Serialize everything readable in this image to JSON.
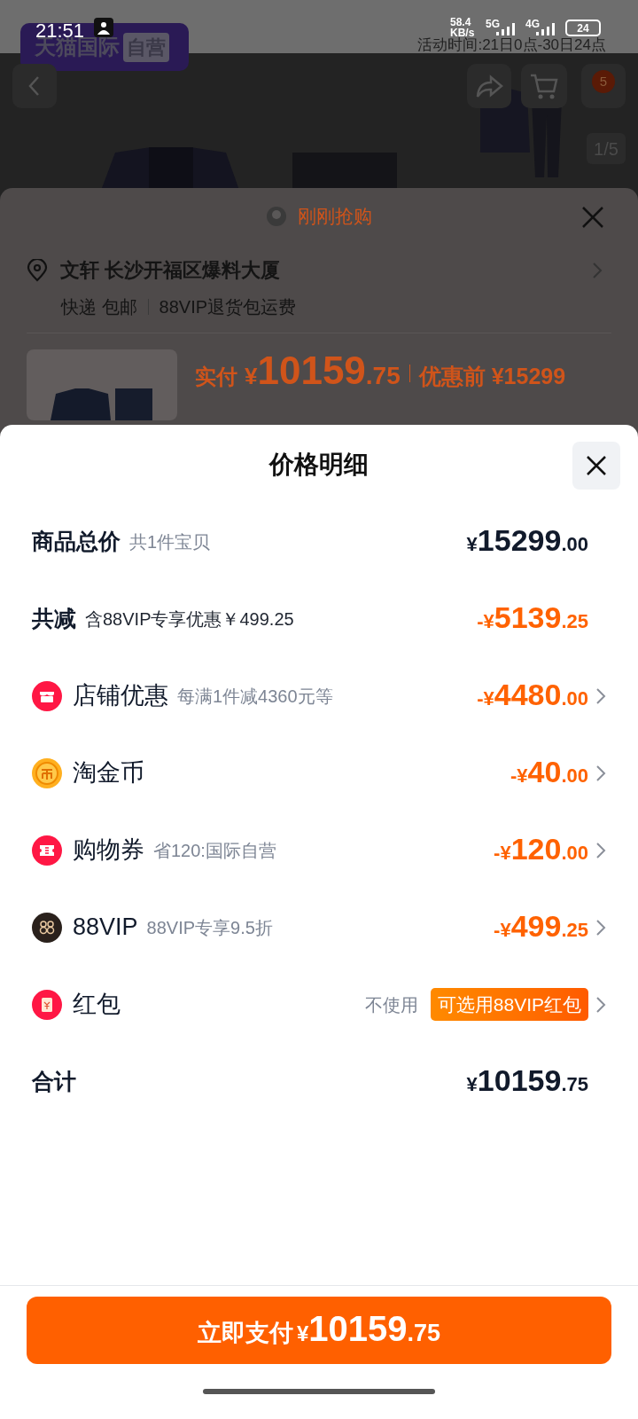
{
  "status_bar": {
    "time": "21:51",
    "speed_value": "58.4",
    "speed_unit": "KB/s",
    "networks": [
      "5G",
      "4G"
    ],
    "battery": "24"
  },
  "banner": {
    "logo": "天猫国际",
    "logo_tag": "自营",
    "activity": "活动时间:21日0点-30日24点"
  },
  "product_header": {
    "cart_badge": "5",
    "image_counter": "1/5"
  },
  "order_sheet": {
    "title": "刚刚抢购",
    "address": "文轩 长沙开福区爆料大厦",
    "shipping": "快递 包邮",
    "return_note": "88VIP退货包运费",
    "price_label": "实付",
    "currency": "¥",
    "price_integer": "10159",
    "price_decimal": ".75",
    "original_price": "优惠前 ¥15299"
  },
  "price_detail": {
    "title": "价格明细",
    "rows": [
      {
        "kind": "summary",
        "label": "商品总价",
        "note": "共1件宝贝",
        "amount": {
          "prefix": "¥",
          "integer": "15299",
          "decimal": ".00"
        },
        "deduction": false,
        "chevron": false
      },
      {
        "kind": "summary",
        "label": "共减",
        "note": "含88VIP专享优惠￥499.25",
        "amount": {
          "prefix": "-¥",
          "integer": "5139",
          "decimal": ".25"
        },
        "deduction": true,
        "chevron": false
      },
      {
        "kind": "shop",
        "label": "店铺优惠",
        "note": "每满1件减4360元等",
        "amount": {
          "prefix": "-¥",
          "integer": "4480",
          "decimal": ".00"
        },
        "deduction": true,
        "chevron": true
      },
      {
        "kind": "coin",
        "label": "淘金币",
        "amount": {
          "prefix": "-¥",
          "integer": "40",
          "decimal": ".00"
        },
        "deduction": true,
        "chevron": true
      },
      {
        "kind": "coupon",
        "label": "购物券",
        "note": "省120:国际自营",
        "amount": {
          "prefix": "-¥",
          "integer": "120",
          "decimal": ".00"
        },
        "deduction": true,
        "chevron": true
      },
      {
        "kind": "vip",
        "label": "88VIP",
        "note": "88VIP专享9.5折",
        "amount": {
          "prefix": "-¥",
          "integer": "499",
          "decimal": ".25"
        },
        "deduction": true,
        "chevron": true
      },
      {
        "kind": "packet",
        "label": "红包",
        "value_text": "不使用",
        "badge": "可选用88VIP红包",
        "chevron": true
      },
      {
        "kind": "summary",
        "label": "合计",
        "amount": {
          "prefix": "¥",
          "integer": "10159",
          "decimal": ".75"
        },
        "deduction": false,
        "chevron": false
      }
    ]
  },
  "pay_button": {
    "label": "立即支付",
    "currency": "¥",
    "integer": "10159",
    "decimal": ".75"
  }
}
